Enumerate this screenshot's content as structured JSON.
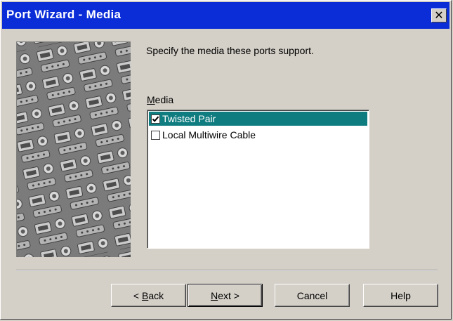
{
  "window": {
    "title": "Port Wizard - Media",
    "close_icon": "close-icon"
  },
  "content": {
    "instruction": "Specify the media these ports support.",
    "media_label_accel": "M",
    "media_label_rest": "edia",
    "media_items": [
      {
        "label": "Twisted Pair",
        "checked": true,
        "selected": true
      },
      {
        "label": "Local Multiwire Cable",
        "checked": false,
        "selected": false
      }
    ]
  },
  "buttons": {
    "back_prefix": "< ",
    "back_accel": "B",
    "back_rest": "ack",
    "next_accel": "N",
    "next_rest": "ext >",
    "cancel": "Cancel",
    "help": "Help"
  },
  "colors": {
    "titlebar": "#0a2dd8",
    "selection": "#0f7c80",
    "face": "#d4d0c8"
  }
}
